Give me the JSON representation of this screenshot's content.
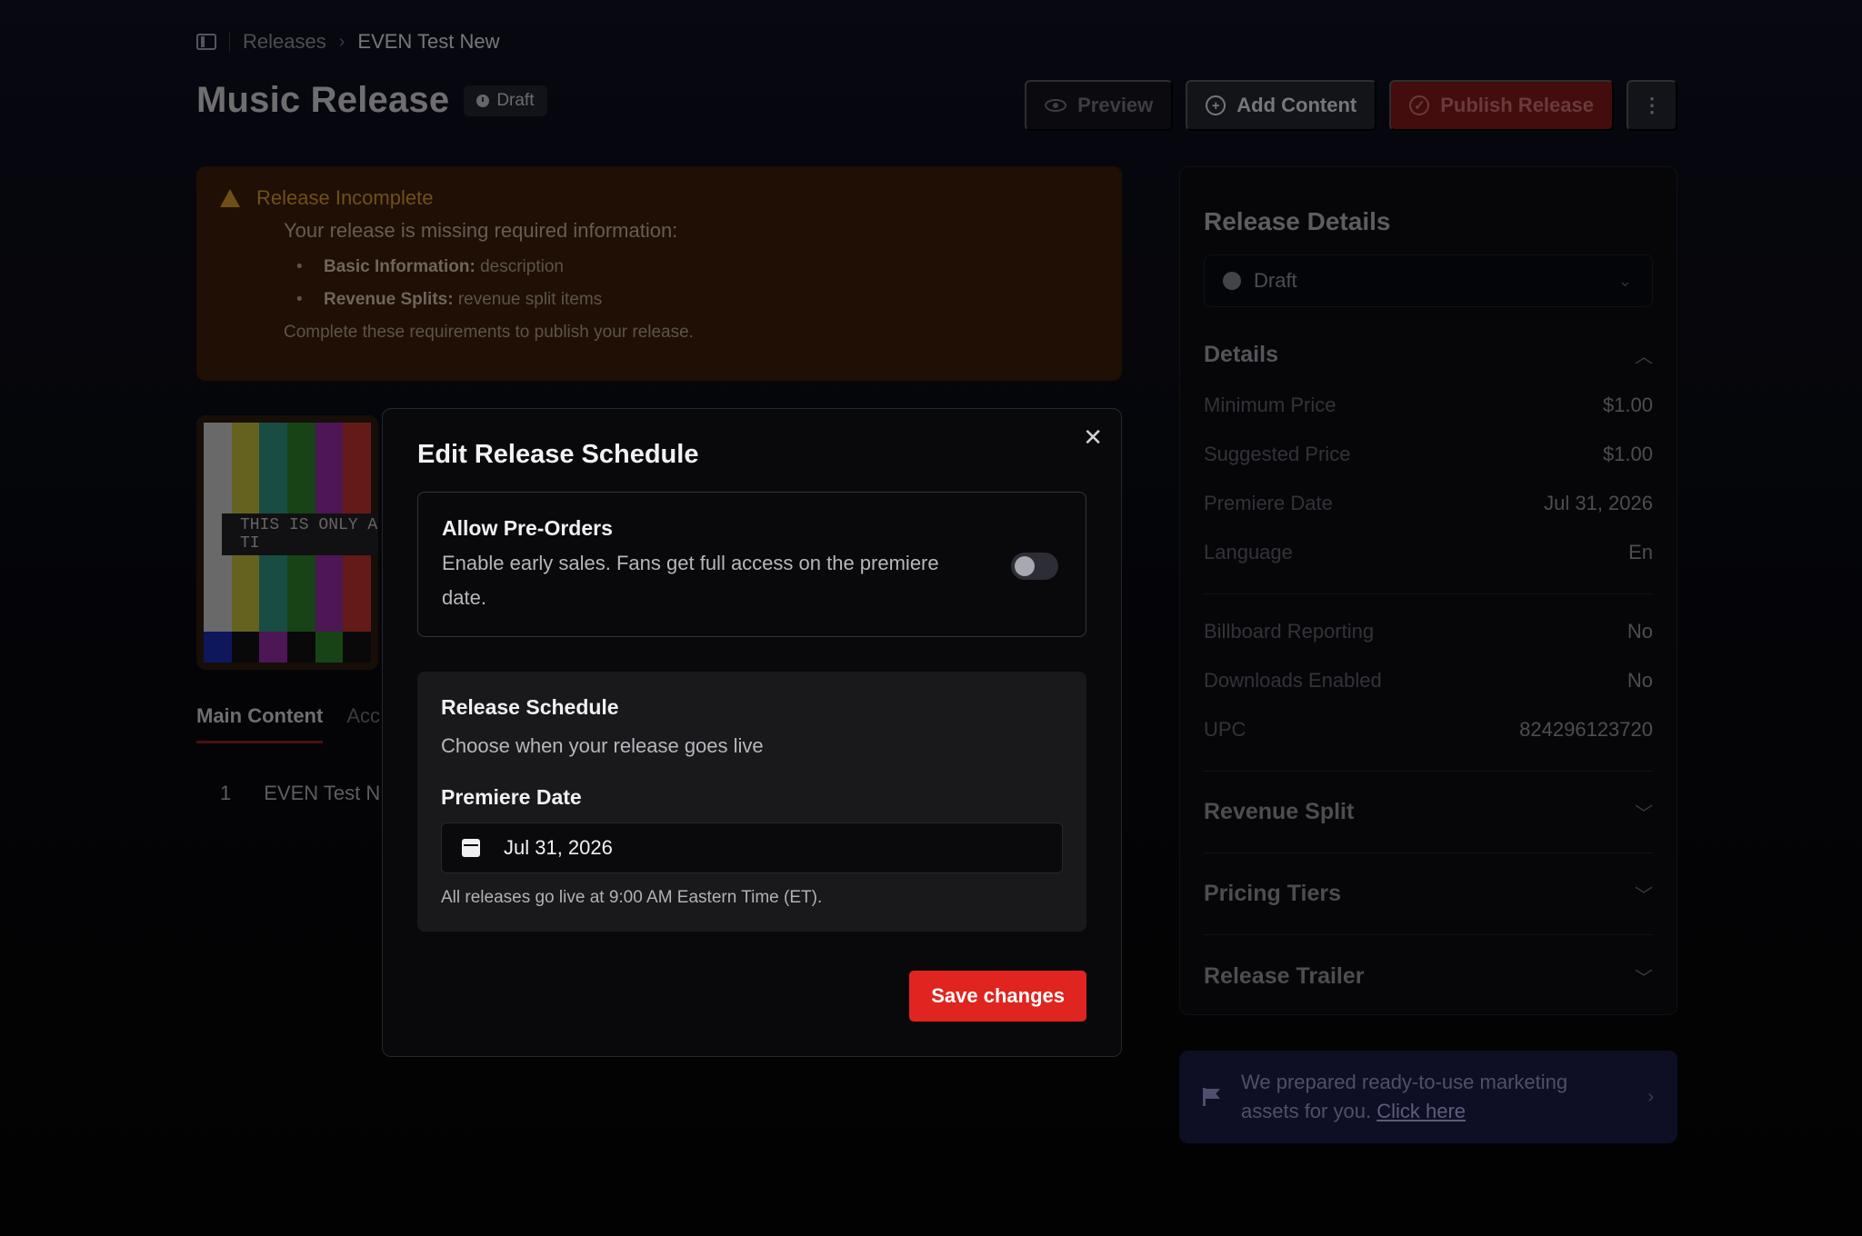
{
  "breadcrumb": {
    "root": "Releases",
    "current": "EVEN Test New"
  },
  "header": {
    "title": "Music Release",
    "status_badge": "Draft"
  },
  "actions": {
    "preview": "Preview",
    "add_content": "Add Content",
    "publish": "Publish Release",
    "more": "⋮"
  },
  "warning": {
    "title": "Release Incomplete",
    "subtitle": "Your release is missing required information:",
    "items": [
      {
        "label": "Basic Information:",
        "value": "description"
      },
      {
        "label": "Revenue Splits:",
        "value": "revenue split items"
      }
    ],
    "footer": "Complete these requirements to publish your release."
  },
  "thumbnail": {
    "overlay_text": "THIS IS ONLY A TI"
  },
  "tabs": [
    {
      "label": "Main Content"
    },
    {
      "label": "Acc"
    }
  ],
  "content_list": [
    {
      "index": "1",
      "title": "EVEN Test N"
    }
  ],
  "release_details": {
    "title": "Release Details",
    "status_select": "Draft",
    "details_heading": "Details",
    "rows": [
      {
        "label": "Minimum Price",
        "value": "$1.00"
      },
      {
        "label": "Suggested Price",
        "value": "$1.00"
      },
      {
        "label": "Premiere Date",
        "value": "Jul 31, 2026"
      },
      {
        "label": "Language",
        "value": "En"
      }
    ],
    "rows2": [
      {
        "label": "Billboard Reporting",
        "value": "No"
      },
      {
        "label": "Downloads Enabled",
        "value": "No"
      },
      {
        "label": "UPC",
        "value": "824296123720"
      }
    ],
    "accordions": [
      "Revenue Split",
      "Pricing Tiers",
      "Release Trailer"
    ]
  },
  "marketing": {
    "text": "We prepared ready-to-use marketing assets for you.",
    "link": "Click here"
  },
  "modal": {
    "title": "Edit Release Schedule",
    "preorders": {
      "title": "Allow Pre-Orders",
      "description": "Enable early sales. Fans get full access on the premiere date.",
      "enabled": false
    },
    "schedule": {
      "title": "Release Schedule",
      "subtitle": "Choose when your release goes live",
      "date_label": "Premiere Date",
      "date_value": "Jul 31, 2026",
      "note": "All releases go live at 9:00 AM Eastern Time (ET)."
    },
    "save_label": "Save changes"
  },
  "colors": {
    "accent": "#e0241f",
    "warning": "#c9922a",
    "marketing_bg": "#1a1a44"
  }
}
